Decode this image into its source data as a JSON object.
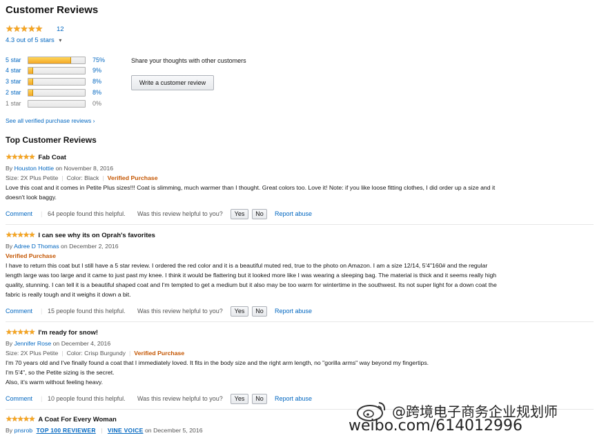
{
  "header": {
    "title": "Customer Reviews",
    "rating_stars": "★★★★★",
    "review_count": "12",
    "rating_text": "4.3 out of 5 stars",
    "caret": "▾"
  },
  "histogram": [
    {
      "label": "5 star",
      "percent": 75,
      "percent_text": "75%"
    },
    {
      "label": "4 star",
      "percent": 9,
      "percent_text": "9%"
    },
    {
      "label": "3 star",
      "percent": 8,
      "percent_text": "8%"
    },
    {
      "label": "2 star",
      "percent": 8,
      "percent_text": "8%"
    },
    {
      "label": "1 star",
      "percent": 0,
      "percent_text": "0%"
    }
  ],
  "share": {
    "prompt": "Share your thoughts with other customers",
    "button": "Write a customer review"
  },
  "see_all": "See all verified purchase reviews ›",
  "top_reviews_title": "Top Customer Reviews",
  "common": {
    "comment": "Comment",
    "helpful_q": "Was this review helpful to you?",
    "yes": "Yes",
    "no": "No",
    "report": "Report abuse",
    "by": "By",
    "on": "on",
    "verified": "Verified Purchase",
    "stars": "★★★★★"
  },
  "reviews": [
    {
      "title": "Fab Coat",
      "author": "Houston Hottie",
      "date": "November 8, 2016",
      "size": "Size: 2X Plus Petite",
      "color": "Color: Black",
      "body": [
        "Love this coat and it comes in Petite Plus sizes!!! Coat is slimming, much warmer than I thought. Great colors too. Love it! Note: if you like loose fitting clothes, I did order up a size and it",
        "doesn't look baggy."
      ],
      "helpful": "64 people found this helpful."
    },
    {
      "title": "I can see why its on Oprah's favorites",
      "author": "Adree D Thomas",
      "date": "December 2, 2016",
      "body": [
        "I have to return this coat but I still have a 5 star review. I ordered the red color and it is a beautiful muted red, true to the photo on Amazon. I am a size 12/14, 5'4\"160# and the regular",
        "length large was too large and it came to just past my knee. I think it would be flattering but it looked more like I was wearing a sleeping bag. The material is thick and it seems really high",
        "quality, stunning. I can tell it is a beautiful shaped coat and I'm tempted to get a medium but it also may be too warm for wintertime in the southwest. Its not super light for a down coat the",
        "fabric is really tough and it weighs it down a bit."
      ],
      "helpful": "15 people found this helpful."
    },
    {
      "title": "I'm ready for snow!",
      "author": "Jennifer Rose",
      "date": "December 4, 2016",
      "size": "Size: 2X Plus Petite",
      "color": "Color: Crisp Burgundy",
      "body": [
        "I'm 70 years old and I've finally found a coat that I immediately loved. It fits in the body size and the right arm length, no \"gorilla arms\" way beyond my fingertips.",
        "I'm 5'4\", so the Petite sizing is the secret.",
        "Also, it's warm without feeling heavy."
      ],
      "helpful": "10 people found this helpful."
    },
    {
      "title": "A Coat For Every Woman",
      "author": "pnsrob",
      "badge1": "TOP 100 REVIEWER",
      "badge2": "VINE VOICE",
      "date": "December 5, 2016"
    }
  ],
  "watermark": {
    "handle": "@跨境电子商务企业规划师",
    "url": "weibo.com/614012996"
  }
}
